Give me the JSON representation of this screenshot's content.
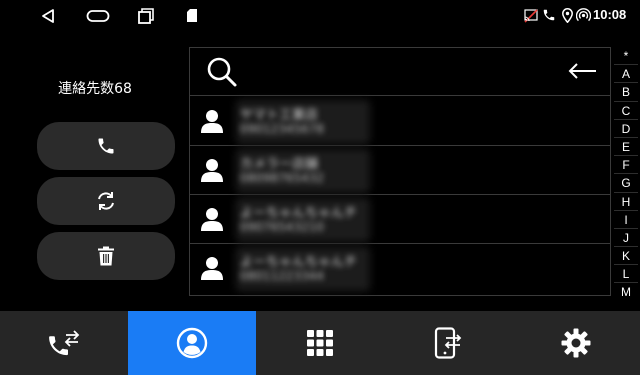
{
  "status_bar": {
    "time": "10:08",
    "icons": [
      "back-icon",
      "home-icon",
      "recents-icon",
      "sd-card-icon",
      "cast-off-icon",
      "phone-icon",
      "location-icon",
      "hotspot-icon"
    ]
  },
  "left_panel": {
    "contact_count_label": "連絡先数68",
    "buttons": [
      "call-icon",
      "sync-icon",
      "trash-icon"
    ]
  },
  "search": {
    "icon": "search-icon",
    "back_icon": "arrow-left-icon"
  },
  "contacts": [
    {
      "name": "ヤマト工業店",
      "number": "09012345678"
    },
    {
      "name": "カメラー店舗",
      "number": "08098765432"
    },
    {
      "name": "よーちゃんちゃんチ",
      "number": "09076543210"
    },
    {
      "name": "よーちゃんちゃんチ",
      "number": "08011223344"
    }
  ],
  "alphabet_index": [
    "*",
    "A",
    "B",
    "C",
    "D",
    "E",
    "F",
    "G",
    "H",
    "I",
    "J",
    "K",
    "L",
    "M"
  ],
  "bottom_nav": {
    "items": [
      "call-log-icon",
      "contacts-icon",
      "dialpad-icon",
      "phone-transfer-icon",
      "settings-gear-icon"
    ],
    "active_index": 1,
    "active_color": "#1a7cf5"
  }
}
